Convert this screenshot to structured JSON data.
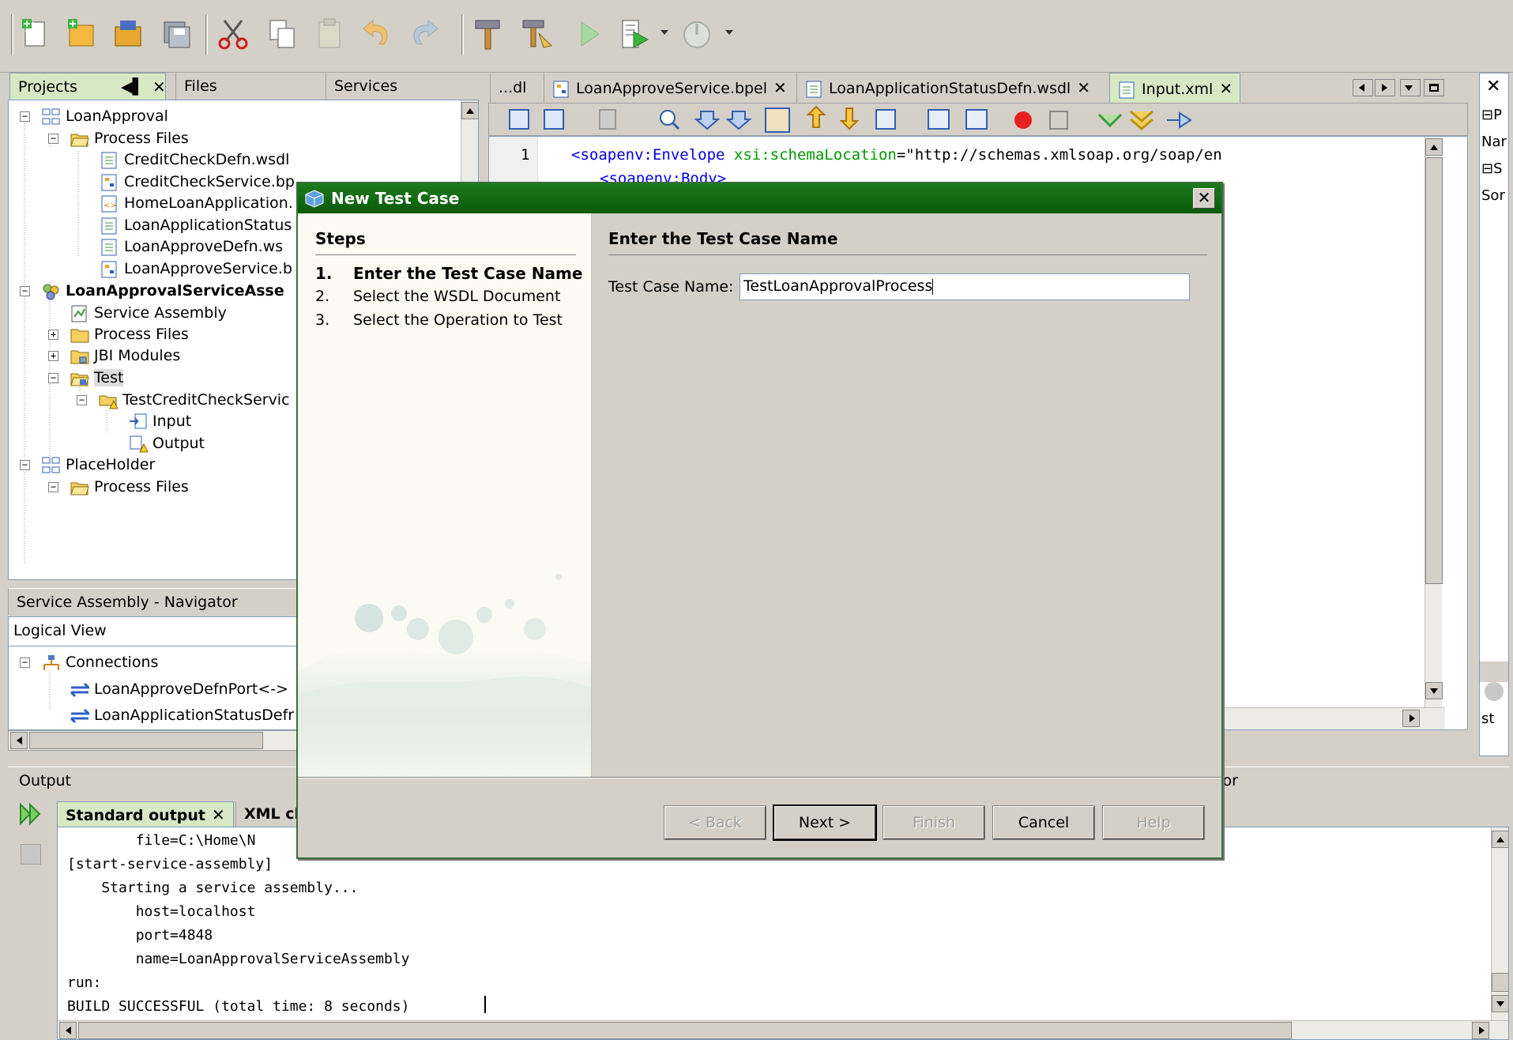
{
  "projects_panel": {
    "tabs": [
      {
        "label": "Projects",
        "active": true
      },
      {
        "label": "Files",
        "active": false
      },
      {
        "label": "Services",
        "active": false
      }
    ],
    "tree": [
      {
        "label": "LoanApproval",
        "level": 0,
        "bold": false
      },
      {
        "label": "Process Files",
        "level": 1,
        "bold": false
      },
      {
        "label": "CreditCheckDefn.wsdl",
        "level": 2,
        "bold": false
      },
      {
        "label": "CreditCheckService.bp",
        "level": 2,
        "bold": false
      },
      {
        "label": "HomeLoanApplication.",
        "level": 2,
        "bold": false
      },
      {
        "label": "LoanApplicationStatus",
        "level": 2,
        "bold": false
      },
      {
        "label": "LoanApproveDefn.ws",
        "level": 2,
        "bold": false
      },
      {
        "label": "LoanApproveService.b",
        "level": 2,
        "bold": false
      },
      {
        "label": "LoanApprovalServiceAsse",
        "level": 0,
        "bold": true
      },
      {
        "label": "Service Assembly",
        "level": 1,
        "bold": false
      },
      {
        "label": "Process Files",
        "level": 1,
        "bold": false
      },
      {
        "label": "JBI Modules",
        "level": 1,
        "bold": false
      },
      {
        "label": "Test",
        "level": 1,
        "bold": false
      },
      {
        "label": "TestCreditCheckServic",
        "level": 2,
        "bold": false
      },
      {
        "label": "Input",
        "level": 3,
        "bold": false
      },
      {
        "label": "Output",
        "level": 3,
        "bold": false
      },
      {
        "label": "PlaceHolder",
        "level": 0,
        "bold": false
      },
      {
        "label": "Process Files",
        "level": 1,
        "bold": false
      }
    ]
  },
  "navigator": {
    "title": "Service Assembly - Navigator",
    "view_select": "Logical View",
    "items": [
      {
        "label": "Connections"
      },
      {
        "label": "LoanApproveDefnPort<->"
      },
      {
        "label": "LoanApplicationStatusDefr"
      }
    ]
  },
  "editor": {
    "tabs": [
      {
        "label": "...dl"
      },
      {
        "label": "LoanApproveService.bpel"
      },
      {
        "label": "LoanApplicationStatusDefn.wsdl"
      },
      {
        "label": "Input.xml"
      }
    ],
    "line_number": "1",
    "code": {
      "tag": "<soapenv:Envelope",
      "attr": "xsi:schemaLocation",
      "eq": "=",
      "value": "\"http://schemas.xmlsoap.org/soap/en"
    },
    "line2_fragment": "<soapenv:Body>"
  },
  "right_panel": {
    "items": [
      "P",
      "Nar",
      "S",
      "Sor"
    ],
    "fragment": "st"
  },
  "output": {
    "title": "Output",
    "tabs": [
      {
        "label": "Standard output"
      },
      {
        "label": "XML ch"
      }
    ],
    "lines": [
      "        file=C:\\Home\\N",
      "[start-service-assembly]",
      "    Starting a service assembly...",
      "        host=localhost",
      "        port=4848",
      "        name=LoanApprovalServiceAssembly",
      "run:",
      "BUILD SUCCESSFUL (total time: 8 seconds)"
    ],
    "behind_fragment": "tor"
  },
  "dialog": {
    "title": "New Test Case",
    "steps_heading": "Steps",
    "steps": [
      {
        "num": "1.",
        "label": "Enter the Test Case Name"
      },
      {
        "num": "2.",
        "label": "Select the WSDL Document"
      },
      {
        "num": "3.",
        "label": "Select the Operation to Test"
      }
    ],
    "content_heading": "Enter the Test Case Name",
    "field_label": "Test Case Name:",
    "field_value": "TestLoanApprovalProcess",
    "buttons": {
      "back": "< Back",
      "next": "Next >",
      "finish": "Finish",
      "cancel": "Cancel",
      "help": "Help"
    }
  },
  "colors": {
    "dialog_title": "#0a5a0a",
    "active_tab": "#d7e8c4",
    "xml_tag": "#0000e6",
    "xml_attr": "#009900"
  }
}
